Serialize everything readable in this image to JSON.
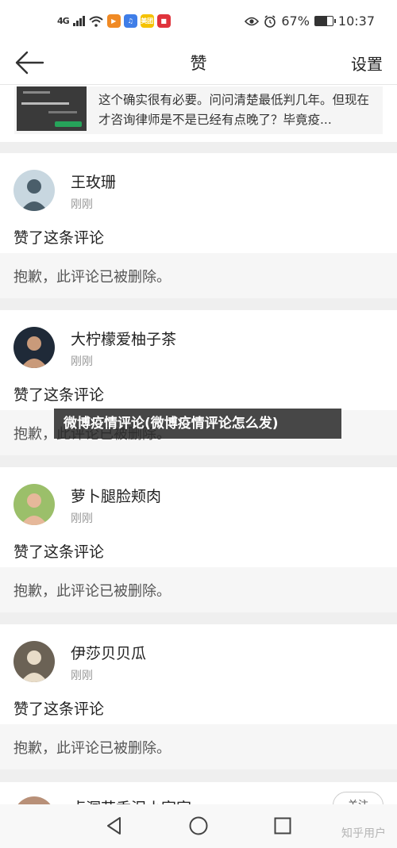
{
  "status_bar": {
    "signal": "4G",
    "app_icons": [
      {
        "name": "video-app-icon",
        "color": "#f08a24",
        "glyph": "▶"
      },
      {
        "name": "music-app-icon",
        "color": "#3f7ee8",
        "glyph": "♫"
      },
      {
        "name": "meituan-app-icon",
        "color": "#f5c200",
        "glyph": "美团"
      },
      {
        "name": "red-app-icon",
        "color": "#e0333c",
        "glyph": "■"
      }
    ],
    "battery": "67%",
    "battery_level": 0.67,
    "time": "10:37"
  },
  "header": {
    "title": "赞",
    "settings_label": "设置"
  },
  "top_card": {
    "quote": "这个确实很有必要。问问清楚最低判几年。但现在才咨询律师是不是已经有点晚了？毕竟疫..."
  },
  "cards": [
    {
      "name": "王玫珊",
      "time": "刚刚",
      "action": "赞了这条评论",
      "deleted": "抱歉，此评论已被删除。",
      "avatar_bg": "#c8d7e0",
      "avatar_fg": "#4a5e6a"
    },
    {
      "name": "大柠檬爱柚子茶",
      "time": "刚刚",
      "action": "赞了这条评论",
      "deleted": "抱歉，此评论已被删除。",
      "avatar_bg": "#1f2a38",
      "avatar_fg": "#c99a7a"
    },
    {
      "name": "萝卜腿脸颊肉",
      "time": "刚刚",
      "action": "赞了这条评论",
      "deleted": "抱歉，此评论已被删除。",
      "avatar_bg": "#9bbf6a",
      "avatar_fg": "#e6b89a"
    },
    {
      "name": "伊莎贝贝瓜",
      "time": "刚刚",
      "action": "赞了这条评论",
      "deleted": "抱歉，此评论已被删除。",
      "avatar_bg": "#6b6255",
      "avatar_fg": "#e8dcc8"
    }
  ],
  "last_card": {
    "name": "贞洞花香泥小家家",
    "follow_label": "关注",
    "avatar_bg": "#b89078"
  },
  "banner": {
    "text": "微博疫情评论(微博疫情评论怎么发)"
  },
  "watermark": "知乎用户"
}
